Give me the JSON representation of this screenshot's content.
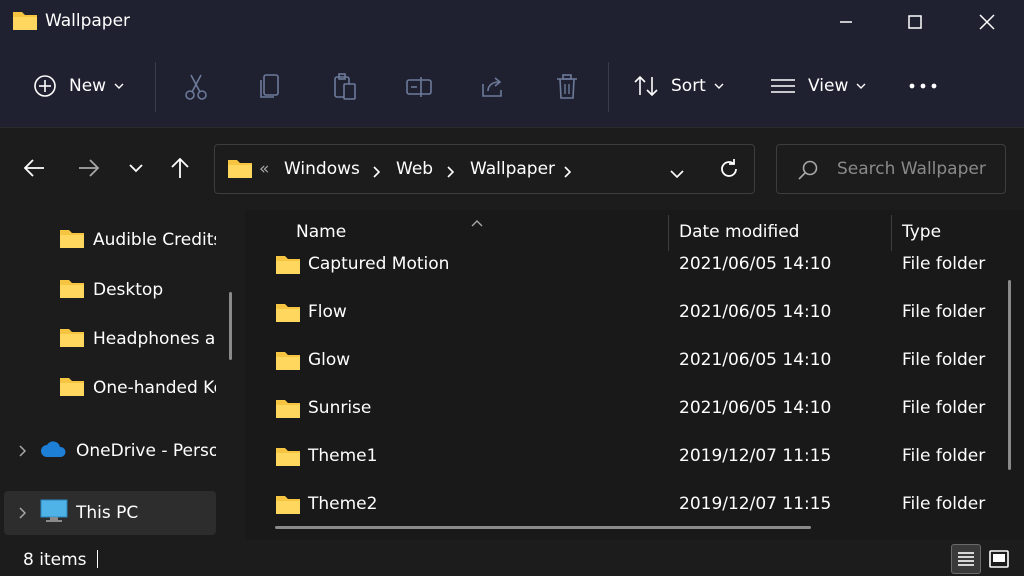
{
  "window": {
    "title": "Wallpaper",
    "accent_color": "#1f2130",
    "folder_color": "#f5c542"
  },
  "toolbar": {
    "new_label": "New",
    "sort_label": "Sort",
    "view_label": "View",
    "icons": [
      "cut-icon",
      "copy-icon",
      "paste-icon",
      "rename-icon",
      "share-icon",
      "delete-icon",
      "more-icon"
    ]
  },
  "address": {
    "overflow": "«",
    "crumbs": [
      "Windows",
      "Web",
      "Wallpaper"
    ]
  },
  "search": {
    "placeholder": "Search Wallpaper"
  },
  "sidebar": {
    "items": [
      {
        "label": "Audible Credits"
      },
      {
        "label": "Desktop"
      },
      {
        "label": "Headphones ar"
      },
      {
        "label": "One-handed Ke"
      },
      {
        "label": "OneDrive - Perso"
      },
      {
        "label": "This PC"
      }
    ]
  },
  "columns": {
    "name": "Name",
    "date": "Date modified",
    "type": "Type"
  },
  "files": [
    {
      "name": "Captured Motion",
      "date": "2021/06/05 14:10",
      "type": "File folder"
    },
    {
      "name": "Flow",
      "date": "2021/06/05 14:10",
      "type": "File folder"
    },
    {
      "name": "Glow",
      "date": "2021/06/05 14:10",
      "type": "File folder"
    },
    {
      "name": "Sunrise",
      "date": "2021/06/05 14:10",
      "type": "File folder"
    },
    {
      "name": "Theme1",
      "date": "2019/12/07 11:15",
      "type": "File folder"
    },
    {
      "name": "Theme2",
      "date": "2019/12/07 11:15",
      "type": "File folder"
    }
  ],
  "status": {
    "item_count": "8 items"
  }
}
